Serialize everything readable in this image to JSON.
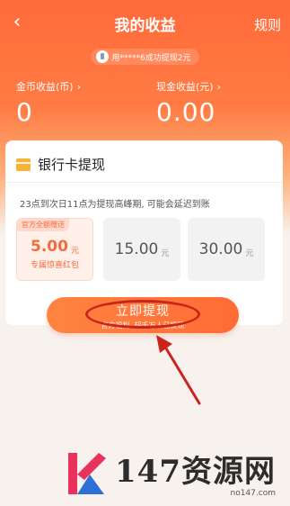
{
  "header": {
    "title": "我的收益",
    "rules_label": "规则",
    "back_icon": "chevron-left-icon"
  },
  "notice": {
    "text": "用*****6成功提现2元"
  },
  "stats": {
    "coin": {
      "label": "金币收益(币)",
      "value": "0"
    },
    "cash": {
      "label": "现金收益(元)",
      "value": "0.00"
    }
  },
  "card": {
    "title": "银行卡提现",
    "peak_note": "23点到次日11点为提现高峰期, 可能会延迟到账",
    "options": [
      {
        "tag": "官方全额赠送",
        "value": "5.00",
        "unit": "元",
        "subtitle": "专属惊喜红包",
        "selected": true
      },
      {
        "value": "15.00",
        "unit": "元",
        "selected": false
      },
      {
        "value": "30.00",
        "unit": "元",
        "selected": false
      }
    ]
  },
  "withdraw_button": {
    "label": "立即提现",
    "subtitle": "官方福利, 超千万人已提现"
  },
  "watermark": {
    "brand": "147资源网",
    "url": "no147.com"
  },
  "colors": {
    "accent": "#ff6b35",
    "annotation": "#c9251d"
  }
}
